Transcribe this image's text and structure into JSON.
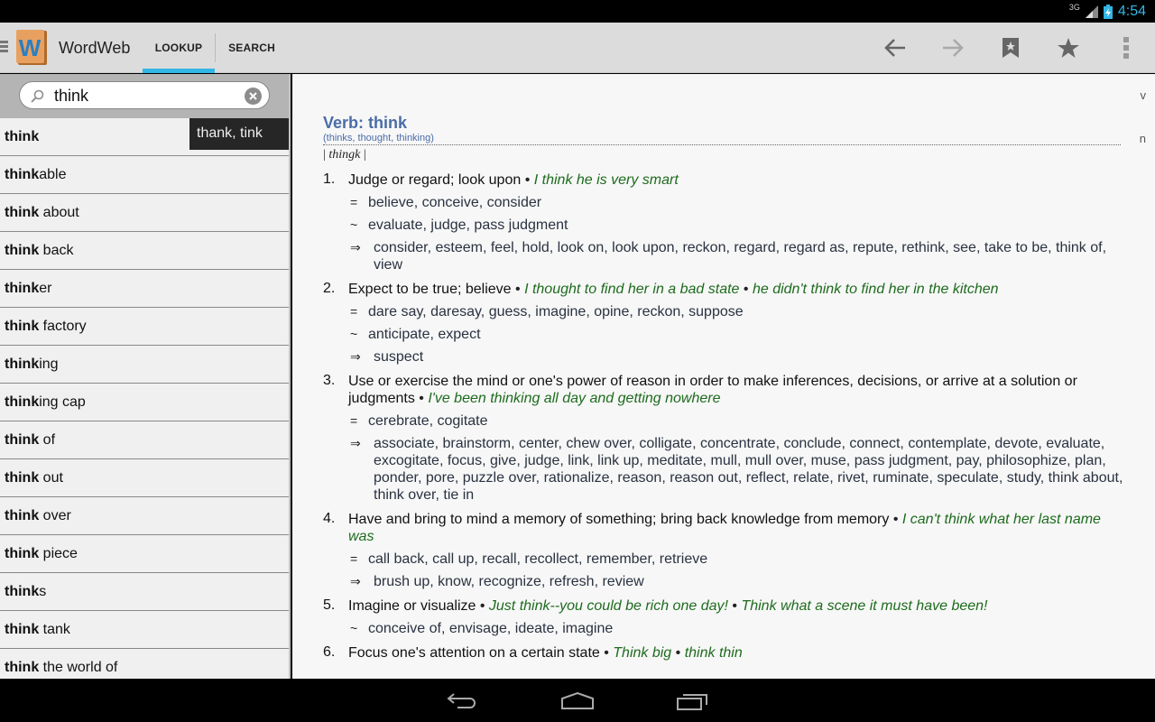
{
  "status_bar": {
    "network": "3G",
    "time": "4:54",
    "clock_color": "#33b5e5"
  },
  "action_bar": {
    "app_title": "WordWeb",
    "tabs": [
      {
        "label": "LOOKUP",
        "active": true
      },
      {
        "label": "SEARCH",
        "active": false
      }
    ],
    "icons": [
      "back-arrow-icon",
      "forward-arrow-icon",
      "bookmark-icon",
      "star-icon",
      "overflow-menu-icon"
    ],
    "accent_color": "#33b5e5"
  },
  "search": {
    "value": "think",
    "placeholder": ""
  },
  "suggestion_popup": "thank, tink",
  "word_list": [
    {
      "bold": "think",
      "rest": ""
    },
    {
      "bold": "think",
      "rest": "able"
    },
    {
      "bold": "think",
      "rest": " about"
    },
    {
      "bold": "think",
      "rest": " back"
    },
    {
      "bold": "think",
      "rest": "er"
    },
    {
      "bold": "think",
      "rest": " factory"
    },
    {
      "bold": "think",
      "rest": "ing"
    },
    {
      "bold": "think",
      "rest": "ing cap"
    },
    {
      "bold": "think",
      "rest": " of"
    },
    {
      "bold": "think",
      "rest": " out"
    },
    {
      "bold": "think",
      "rest": " over"
    },
    {
      "bold": "think",
      "rest": " piece"
    },
    {
      "bold": "think",
      "rest": "s"
    },
    {
      "bold": "think",
      "rest": " tank"
    },
    {
      "bold": "think",
      "rest": " the world of"
    }
  ],
  "entry": {
    "pos_jump_v": "v",
    "pos_jump_n": "n",
    "title": "Verb: think",
    "forms": "(thinks, thought, thinking)",
    "pron_left": "| ",
    "pron": "thingk",
    "pron_right": " |",
    "definitions": [
      {
        "num": "1.",
        "gloss": "Judge or regard; look upon",
        "examples": [
          "I think he is very smart"
        ],
        "relations": [
          {
            "symbol": "=",
            "words": "believe, conceive, consider"
          },
          {
            "symbol": "~",
            "words": "evaluate, judge, pass judgment"
          },
          {
            "symbol": "⇒",
            "words": "consider, esteem, feel, hold, look on, look upon, reckon, regard, regard as, repute, rethink, see, take to be, think of, view"
          }
        ]
      },
      {
        "num": "2.",
        "gloss": "Expect to be true; believe",
        "examples": [
          "I thought to find her in a bad state",
          "he didn't think to find her in the kitchen"
        ],
        "relations": [
          {
            "symbol": "=",
            "words": "dare say, daresay, guess, imagine, opine, reckon, suppose"
          },
          {
            "symbol": "~",
            "words": "anticipate, expect"
          },
          {
            "symbol": "⇒",
            "words": "suspect"
          }
        ]
      },
      {
        "num": "3.",
        "gloss": "Use or exercise the mind or one's power of reason in order to make inferences, decisions, or arrive at a solution or judgments",
        "examples": [
          "I've been thinking all day and getting nowhere"
        ],
        "relations": [
          {
            "symbol": "=",
            "words": "cerebrate, cogitate"
          },
          {
            "symbol": "⇒",
            "words": "associate, brainstorm, center, chew over, colligate, concentrate, conclude, connect, contemplate, devote, evaluate, excogitate, focus, give, judge, link, link up, meditate, mull, mull over, muse, pass judgment, pay, philosophize, plan, ponder, pore, puzzle over, rationalize, reason, reason out, reflect, relate, rivet, ruminate, speculate, study, think about, think over, tie in"
          }
        ]
      },
      {
        "num": "4.",
        "gloss": "Have and bring to mind a memory of something; bring back knowledge from memory",
        "examples": [
          "I can't think what her last name was"
        ],
        "relations": [
          {
            "symbol": "=",
            "words": "call back, call up, recall, recollect, remember, retrieve"
          },
          {
            "symbol": "⇒",
            "words": "brush up, know, recognize, refresh, review"
          }
        ]
      },
      {
        "num": "5.",
        "gloss": "Imagine or visualize",
        "examples": [
          "Just think--you could be rich one day!",
          "Think what a scene it must have been!"
        ],
        "relations": [
          {
            "symbol": "~",
            "words": "conceive of, envisage, ideate, imagine"
          }
        ]
      },
      {
        "num": "6.",
        "gloss": "Focus one's attention on a certain state",
        "examples": [
          "Think big",
          "think thin"
        ],
        "relations": []
      }
    ]
  },
  "nav_bar": {
    "buttons": [
      "back-nav-icon",
      "home-nav-icon",
      "recent-apps-icon"
    ]
  }
}
